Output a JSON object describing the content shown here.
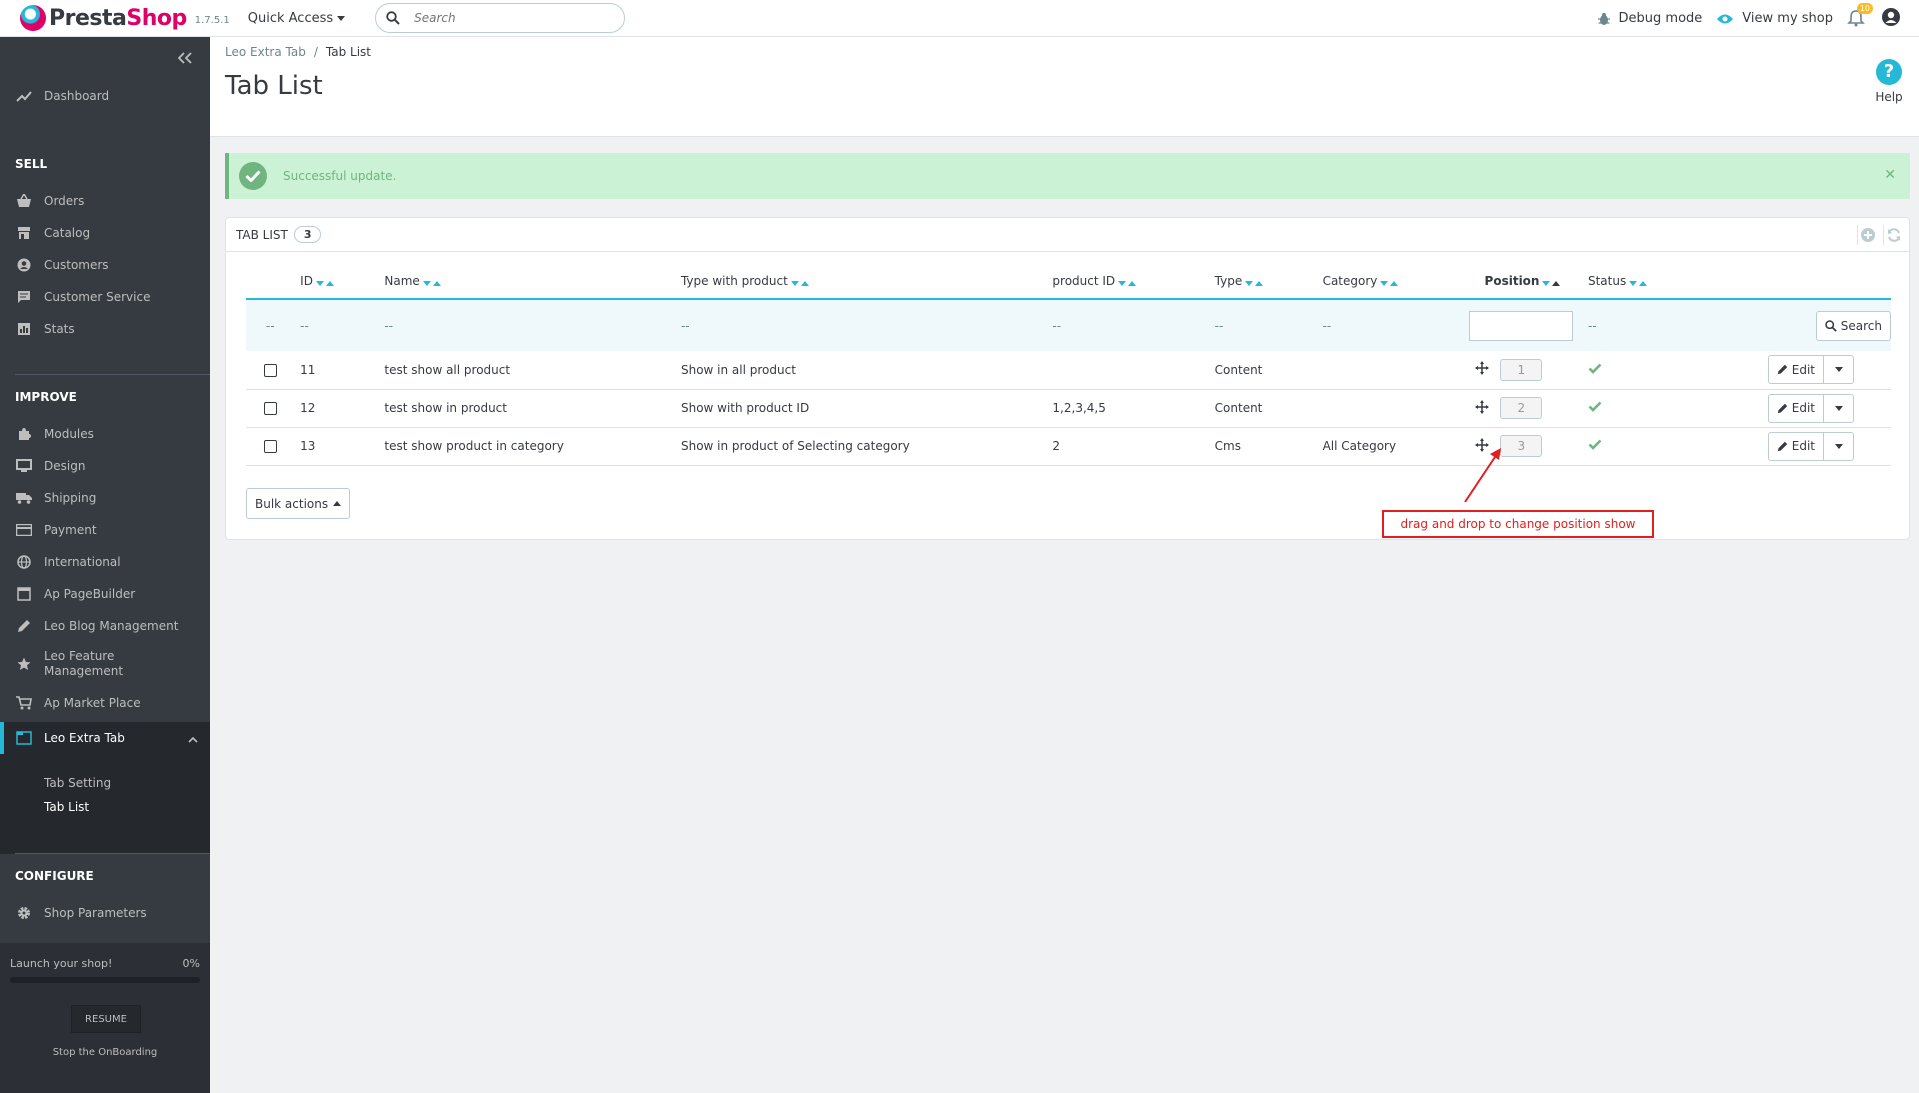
{
  "header": {
    "logo_presta": "Presta",
    "logo_shop": "Shop",
    "version": "1.7.5.1",
    "quick_access": "Quick Access",
    "search_placeholder": "Search",
    "debug_mode": "Debug mode",
    "view_my_shop": "View my shop",
    "notifications_count": "10"
  },
  "sidebar": {
    "dashboard": "Dashboard",
    "sell_title": "SELL",
    "sell_items": [
      "Orders",
      "Catalog",
      "Customers",
      "Customer Service",
      "Stats"
    ],
    "improve_title": "IMPROVE",
    "improve_items": [
      "Modules",
      "Design",
      "Shipping",
      "Payment",
      "International",
      "Ap PageBuilder",
      "Leo Blog Management"
    ],
    "leo_feature_line1": "Leo Feature",
    "leo_feature_line2": "Management",
    "ap_market": "Ap Market Place",
    "leo_extra_tab": "Leo Extra Tab",
    "sub_items": [
      "Tab Setting",
      "Tab List"
    ],
    "configure_title": "CONFIGURE",
    "shop_parameters": "Shop Parameters",
    "onboarding": {
      "label": "Launch your shop!",
      "percent": "0%",
      "progress": 0,
      "resume": "RESUME",
      "stop": "Stop the OnBoarding"
    }
  },
  "page": {
    "breadcrumb_parent": "Leo Extra Tab",
    "breadcrumb_current": "Tab List",
    "title": "Tab List",
    "help": "Help"
  },
  "alert": {
    "message": "Successful update."
  },
  "panel": {
    "title": "TAB LIST",
    "count": "3",
    "columns": [
      "ID",
      "Name",
      "Type with product",
      "product ID",
      "Type",
      "Category",
      "Position",
      "Status"
    ],
    "filter_placeholder": "--",
    "search_button": "Search",
    "rows": [
      {
        "id": "11",
        "name": "test show all product",
        "type_with_product": "Show in all product",
        "product_id": "",
        "type": "Content",
        "category": "",
        "position": "1"
      },
      {
        "id": "12",
        "name": "test show in product",
        "type_with_product": "Show with product ID",
        "product_id": "1,2,3,4,5",
        "type": "Content",
        "category": "",
        "position": "2"
      },
      {
        "id": "13",
        "name": "test show product in category",
        "type_with_product": "Show in product of Selecting category",
        "product_id": "2",
        "type": "Cms",
        "category": "All Category",
        "position": "3"
      }
    ],
    "edit_label": "Edit",
    "bulk_actions": "Bulk actions"
  },
  "annotation": {
    "text": "drag and drop to change position show",
    "color": "#e21e1e"
  },
  "colors": {
    "accent": "#25b9d7",
    "brand": "#df0067",
    "success": "#70b580",
    "sidebar_bg": "#363a41"
  }
}
